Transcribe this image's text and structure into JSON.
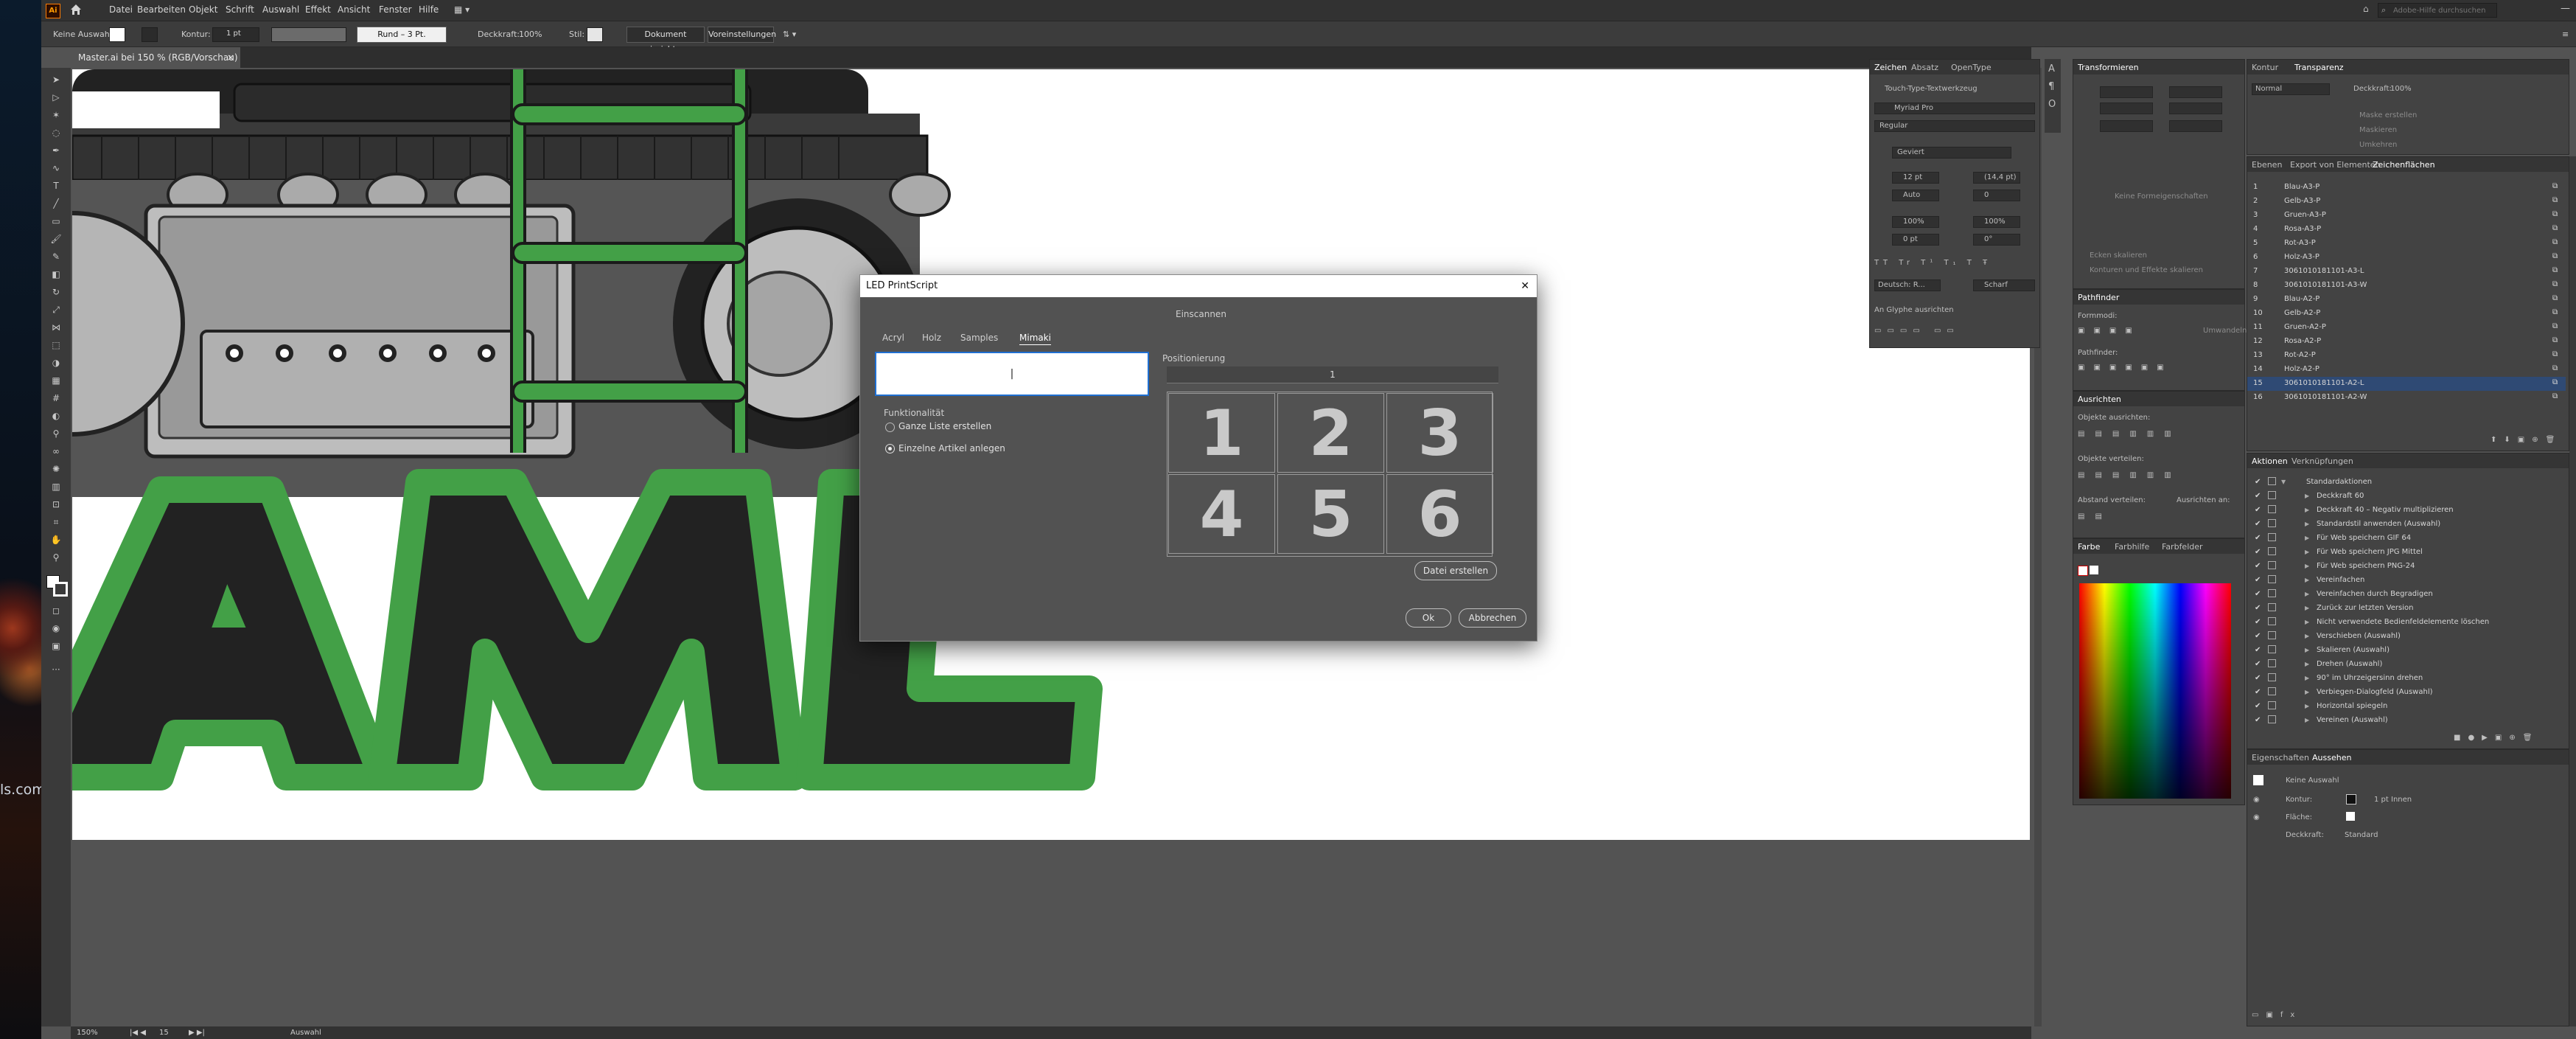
{
  "app": {
    "logo": "Ai",
    "home_icon": "home-icon"
  },
  "menu": [
    "Datei",
    "Bearbeiten",
    "Objekt",
    "Schrift",
    "Auswahl",
    "Effekt",
    "Ansicht",
    "Fenster",
    "Hilfe"
  ],
  "search": {
    "placeholder": "Adobe-Hilfe durchsuchen"
  },
  "control_bar": {
    "selection": "Keine Auswahl",
    "stroke_label": "Kontur:",
    "stroke_value": "1 pt",
    "brush": "Rund – 3 Pt.",
    "opacity_label": "Deckkraft:",
    "opacity_value": "100%",
    "style_label": "Stil:",
    "doc_setup": "Dokument einrichten",
    "preferences": "Voreinstellungen"
  },
  "document_tab": {
    "title": "Master.ai bei 150 % (RGB/Vorschau)",
    "close": "×"
  },
  "dialog": {
    "title": "LED PrintScript",
    "close": "✕",
    "scan_label": "Einscannen",
    "tabs": [
      "Acryl",
      "Holz",
      "Samples",
      "Mimaki"
    ],
    "active_tab": "Mimaki",
    "input_value": "|",
    "function_label": "Funktionalität",
    "radio_all": "Ganze Liste erstellen",
    "radio_single": "Einzelne  Artikel anlegen",
    "positioning_label": "Positionierung",
    "position_value": "1",
    "grid": [
      "1",
      "2",
      "3",
      "4",
      "5",
      "6"
    ],
    "create_file": "Datei erstellen",
    "ok": "Ok",
    "cancel": "Abbrechen"
  },
  "char_panel": {
    "tabs": [
      "Zeichen",
      "Absatz",
      "OpenType"
    ],
    "touch_type": "Touch-Type-Textwerkzeug",
    "font": "Myriad Pro",
    "style": "Regular",
    "size": "12 pt",
    "leading": "(14,4 pt)",
    "kerning": "Auto",
    "tracking": "0",
    "metric": "Geviert",
    "vscale": "100%",
    "hscale": "100%",
    "baseline": "0 pt",
    "rotation": "0°",
    "language": "Deutsch: R...",
    "aa": "Scharf",
    "glyph_align": "An Glyphe ausrichten"
  },
  "transform_panel": {
    "title": "Transformieren",
    "hint": "Keine Formeigenschaften",
    "check1": "Ecken skalieren",
    "check2": "Konturen und Effekte skalieren"
  },
  "pathfinder_panel": {
    "title": "Pathfinder",
    "modes": "Formmodi:",
    "finder": "Pathfinder:",
    "expand": "Umwandeln"
  },
  "align_panel": {
    "title": "Ausrichten",
    "align_objects": "Objekte ausrichten:",
    "distribute": "Objekte verteilen:",
    "spacing": "Abstand verteilen:",
    "align_to": "Ausrichten an:"
  },
  "color_panel": {
    "tabs": [
      "Farbe",
      "Farbhilfe",
      "Farbfelder"
    ]
  },
  "transparency_panel": {
    "tabs": [
      "Kontur",
      "Transparenz"
    ],
    "mode": "Normal",
    "opacity_label": "Deckkraft:",
    "opacity_value": "100%",
    "btn_mask": "Maske erstellen",
    "check1": "Maskieren",
    "check2": "Umkehren"
  },
  "artboards_panel": {
    "tabs": [
      "Ebenen",
      "Export von Elementen",
      "Zeichenflächen"
    ],
    "items": [
      {
        "n": "1",
        "name": "Blau-A3-P"
      },
      {
        "n": "2",
        "name": "Gelb-A3-P"
      },
      {
        "n": "3",
        "name": "Gruen-A3-P"
      },
      {
        "n": "4",
        "name": "Rosa-A3-P"
      },
      {
        "n": "5",
        "name": "Rot-A3-P"
      },
      {
        "n": "6",
        "name": "Holz-A3-P"
      },
      {
        "n": "7",
        "name": "3061010181101-A3-L"
      },
      {
        "n": "8",
        "name": "3061010181101-A3-W"
      },
      {
        "n": "9",
        "name": "Blau-A2-P"
      },
      {
        "n": "10",
        "name": "Gelb-A2-P"
      },
      {
        "n": "11",
        "name": "Gruen-A2-P"
      },
      {
        "n": "12",
        "name": "Rosa-A2-P"
      },
      {
        "n": "13",
        "name": "Rot-A2-P"
      },
      {
        "n": "14",
        "name": "Holz-A2-P"
      },
      {
        "n": "15",
        "name": "3061010181101-A2-L"
      },
      {
        "n": "16",
        "name": "3061010181101-A2-W"
      }
    ]
  },
  "actions_panel": {
    "tabs": [
      "Aktionen",
      "Verknüpfungen"
    ],
    "items": [
      "Standardaktionen",
      "Deckkraft 60",
      "Deckkraft 40 – Negativ multiplizieren",
      "Standardstil anwenden (Auswahl)",
      "Für Web speichern GIF 64",
      "Für Web speichern JPG Mittel",
      "Für Web speichern PNG-24",
      "Vereinfachen",
      "Vereinfachen durch Begradigen",
      "Zurück zur letzten Version",
      "Nicht verwendete Bedienfeldelemente löschen",
      "Verschieben (Auswahl)",
      "Skalieren (Auswahl)",
      "Drehen (Auswahl)",
      "90° im Uhrzeigersinn drehen",
      "Verbiegen-Dialogfeld (Auswahl)",
      "Horizontal spiegeln",
      "Vereinen (Auswahl)"
    ]
  },
  "appearance_panel": {
    "tabs": [
      "Eigenschaften",
      "Aussehen"
    ],
    "no_selection": "Keine Auswahl",
    "stroke_label": "Kontur:",
    "stroke_value": "1 pt  Innen",
    "fill_label": "Fläche:",
    "opacity_label": "Deckkraft:",
    "opacity_value": "Standard"
  },
  "status": {
    "zoom": "150%",
    "artboard": "15",
    "mode": "Auswahl"
  },
  "desktop": {
    "text": "ls.com"
  },
  "colors": {
    "green": "#43a047",
    "dark": "#2b2b2b",
    "panel": "#434343",
    "selected_row": "#2f4a74"
  }
}
